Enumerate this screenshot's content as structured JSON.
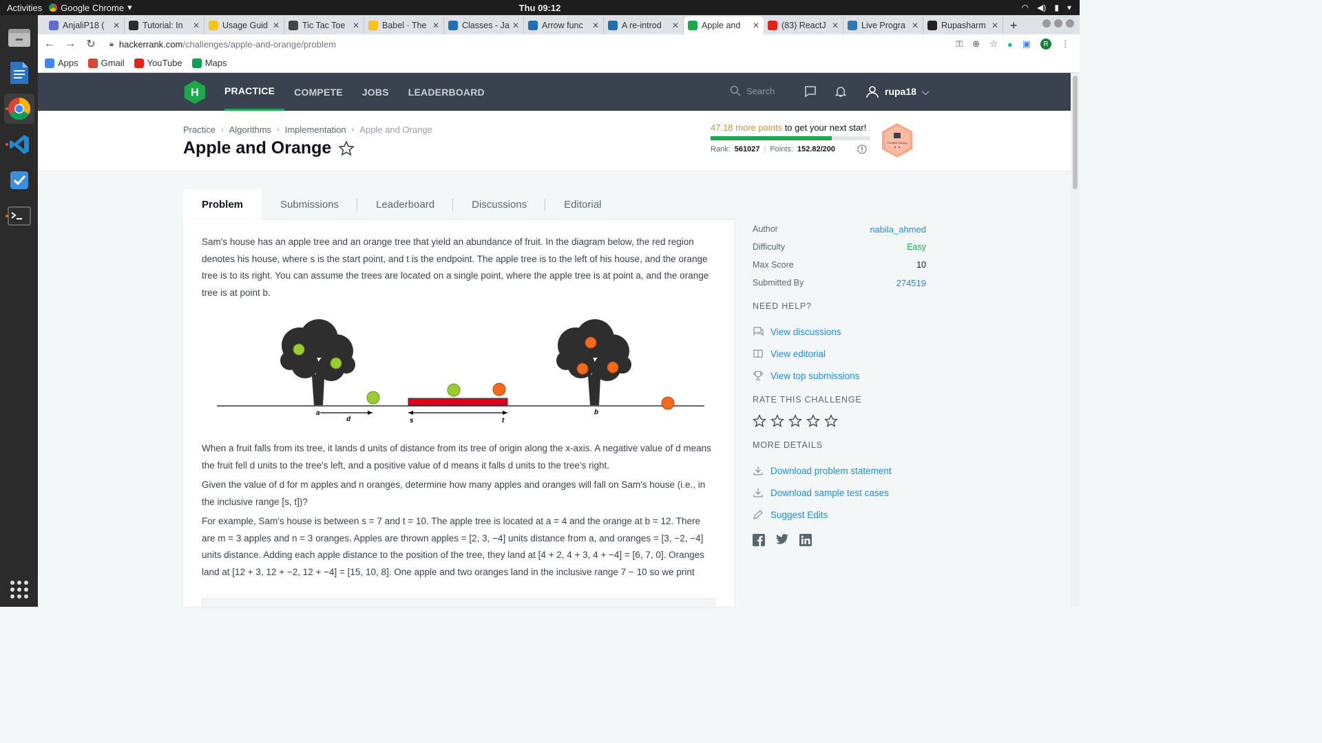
{
  "system": {
    "activities": "Activities",
    "app_name": "Google Chrome",
    "clock": "Thu 09:12"
  },
  "browser": {
    "tabs": [
      {
        "title": "AnjaliP18 (",
        "color": "#5f6bd1"
      },
      {
        "title": "Tutorial: In",
        "color": "#2b2b2b"
      },
      {
        "title": "Usage Guid",
        "color": "#f5c518"
      },
      {
        "title": "Tic Tac Toe",
        "color": "#444"
      },
      {
        "title": "Babel · The",
        "color": "#f5c518"
      },
      {
        "title": "Classes - Ja",
        "color": "#1f6fb2"
      },
      {
        "title": "Arrow func",
        "color": "#1f6fb2"
      },
      {
        "title": "A re-introd",
        "color": "#1f6fb2"
      },
      {
        "title": "Apple and",
        "color": "#1ba94c"
      },
      {
        "title": "(83) ReactJ",
        "color": "#e62117"
      },
      {
        "title": "Live Progra",
        "color": "#3776ab"
      },
      {
        "title": "Rupasharm",
        "color": "#222"
      }
    ],
    "active_tab_index": 8,
    "new_tab": "+",
    "url_domain": "hackerrank.com",
    "url_path": "/challenges/apple-and-orange/problem",
    "profile_initial": "R",
    "bookmarks": [
      {
        "label": "Apps",
        "icon": "apps-grid-icon"
      },
      {
        "label": "Gmail",
        "icon": "gmail-icon"
      },
      {
        "label": "YouTube",
        "icon": "youtube-icon"
      },
      {
        "label": "Maps",
        "icon": "maps-icon"
      }
    ]
  },
  "hr_nav": {
    "logo": "H",
    "items": [
      "PRACTICE",
      "COMPETE",
      "JOBS",
      "LEADERBOARD"
    ],
    "active": "PRACTICE",
    "search_placeholder": "Search",
    "username": "rupa18"
  },
  "header": {
    "breadcrumb": [
      "Practice",
      "Algorithms",
      "Implementation",
      "Apple and Orange"
    ],
    "title": "Apple and Orange",
    "progress_points": "47.18 more points",
    "progress_suffix": " to get your next star!",
    "progress_fraction": 0.76,
    "rank_label": "Rank:",
    "rank": "561027",
    "points_label": "Points:",
    "points": "152.82/200",
    "badge_label": "Problem Solving"
  },
  "problem_tabs": [
    "Problem",
    "Submissions",
    "Leaderboard",
    "Discussions",
    "Editorial"
  ],
  "problem": {
    "p1": "Sam's house has an apple tree and an orange tree that yield an abundance of fruit. In the diagram below, the red region denotes his house, where s is the start point, and t is the endpoint. The apple tree is to the left of his house, and the orange tree is to its right. You can assume the trees are located on a single point, where the apple tree is at point a, and the orange tree is at point b.",
    "diagram_labels": {
      "a": "a",
      "d": "d",
      "s": "s",
      "t": "t",
      "b": "b"
    },
    "p2": "When a fruit falls from its tree, it lands d units of distance from its tree of origin along the x-axis. A negative value of d means the fruit fell d units to the tree's left, and a positive value of d means it falls d units to the tree's right.",
    "p3": "Given the value of d for m apples and n oranges, determine how many apples and oranges will fall on Sam's house (i.e., in the inclusive range [s, t])?",
    "p4": "For example, Sam's house is between s = 7 and t = 10. The apple tree is located at a = 4 and the orange at b = 12. There are m = 3 apples and n = 3 oranges. Apples are thrown apples = [2, 3, −4] units distance from a, and oranges = [3, −2, −4] units distance. Adding each apple distance to the position of the tree, they land at [4 + 2, 4 + 3, 4 + −4] = [6, 7, 0]. Oranges land at [12 + 3, 12 + −2, 12 + −4] = [15, 10, 8]. One apple and two oranges land in the inclusive range 7 − 10 so we print"
  },
  "sidebar": {
    "author_label": "Author",
    "author": "nabila_ahmed",
    "difficulty_label": "Difficulty",
    "difficulty": "Easy",
    "max_score_label": "Max Score",
    "max_score": "10",
    "submitted_label": "Submitted By",
    "submitted": "274519",
    "need_help": "NEED HELP?",
    "help_links": [
      {
        "label": "View discussions",
        "icon": "discussion-icon"
      },
      {
        "label": "View editorial",
        "icon": "book-icon"
      },
      {
        "label": "View top submissions",
        "icon": "trophy-icon"
      }
    ],
    "rate": "RATE THIS CHALLENGE",
    "star_count": 5,
    "more_details": "MORE DETAILS",
    "detail_links": [
      {
        "label": "Download problem statement",
        "icon": "download-icon"
      },
      {
        "label": "Download sample test cases",
        "icon": "download-icon"
      },
      {
        "label": "Suggest Edits",
        "icon": "pencil-icon"
      }
    ],
    "social": [
      "facebook-icon",
      "twitter-icon",
      "linkedin-icon"
    ]
  },
  "colors": {
    "hr_dark": "#39424e",
    "hr_green": "#1ba94c",
    "link_blue": "#1f8dd6",
    "house_red": "#e0001b",
    "apple_green": "#9acd32",
    "orange": "#f26a1b"
  }
}
